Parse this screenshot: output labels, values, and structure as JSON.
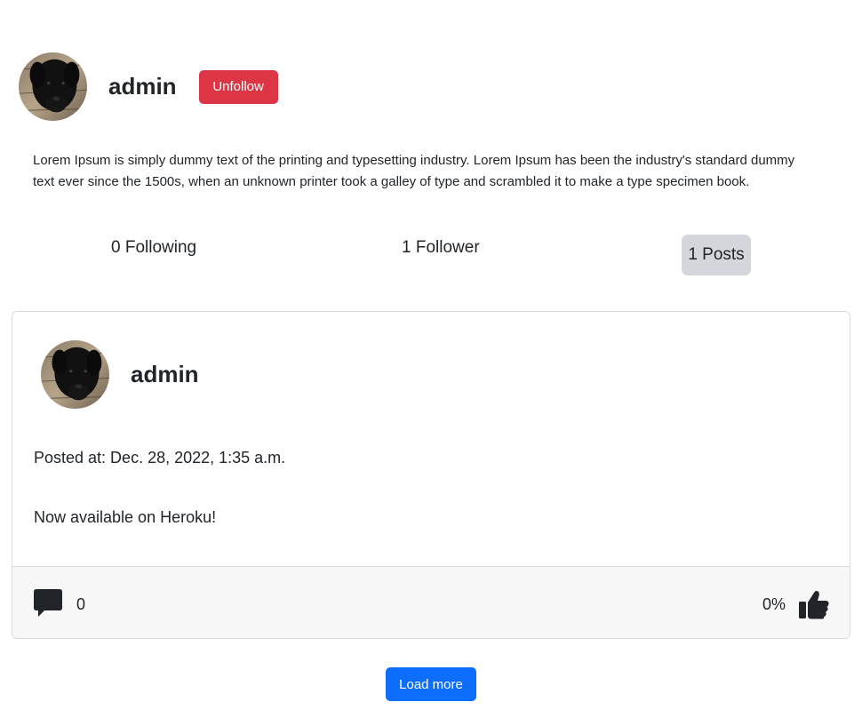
{
  "profile": {
    "username": "admin",
    "unfollow_label": "Unfollow",
    "bio": "Lorem Ipsum is simply dummy text of the printing and typesetting industry. Lorem Ipsum has been the industry's standard dummy text ever since the 1500s, when an unknown printer took a galley of type and scrambled it to make a type specimen book.",
    "following_label": "0 Following",
    "follower_label": "1 Follower",
    "posts_label": "1 Posts"
  },
  "post": {
    "author": "admin",
    "posted_at": "Posted at: Dec. 28, 2022, 1:35 a.m.",
    "body": "Now available on Heroku!",
    "comment_count": "0",
    "like_percent": "0%"
  },
  "load_more_label": "Load more",
  "colors": {
    "danger": "#dc3545",
    "primary": "#0d6efd",
    "active_tab": "#d3d6da",
    "footer_bg": "#f7f7f7"
  }
}
